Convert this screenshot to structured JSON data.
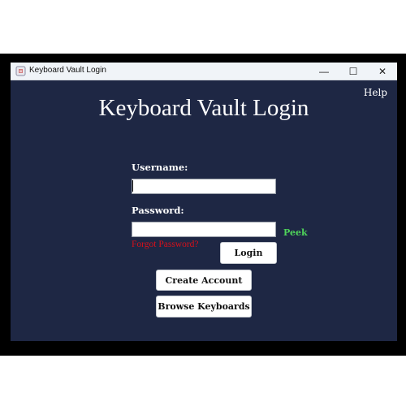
{
  "window": {
    "title": "Keyboard Vault Login",
    "controls": {
      "minimize": "—",
      "maximize": "☐",
      "close": "✕"
    },
    "icon": "app-icon"
  },
  "menu": {
    "help": "Help"
  },
  "heading": "Keyboard Vault Login",
  "form": {
    "username_label": "Username:",
    "username_value": "",
    "password_label": "Password:",
    "password_value": "",
    "peek": "Peek",
    "forgot": "Forgot Password?",
    "login": "Login"
  },
  "actions": {
    "create_account": "Create Account",
    "browse_keyboards": "Browse Keyboards"
  },
  "colors": {
    "background": "#1e2744",
    "peek": "#4fd35a",
    "forgot": "#d8101a"
  }
}
